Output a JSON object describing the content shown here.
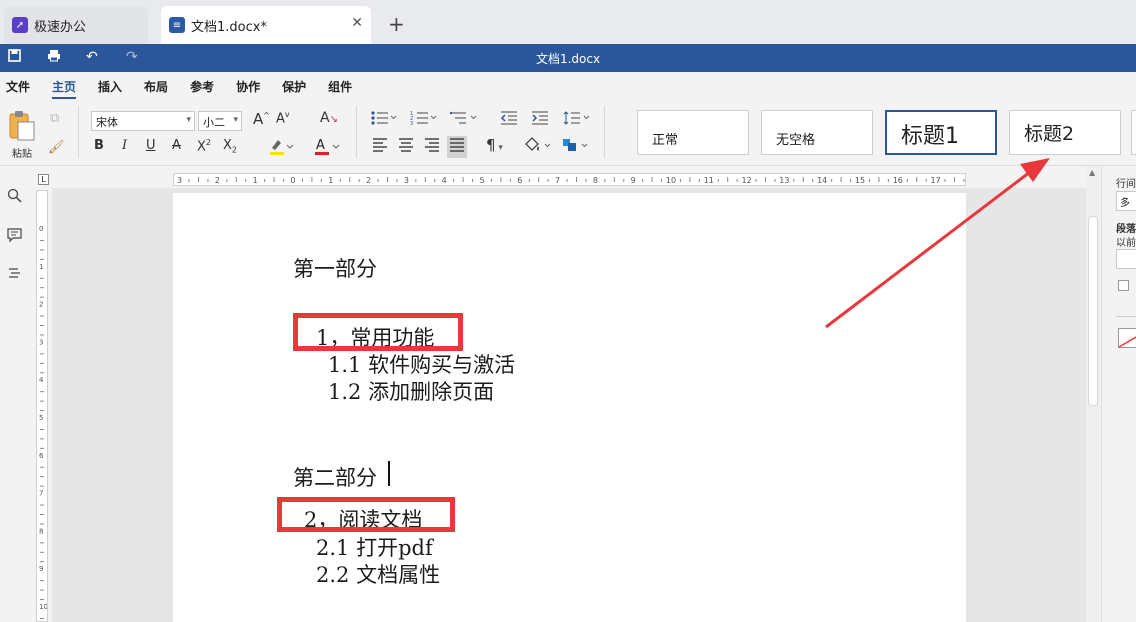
{
  "tabs": {
    "app_tab_label": "极速办公",
    "doc_tab_label": "文档1.docx*",
    "close_glyph": "✕",
    "new_tab_glyph": "+"
  },
  "titlebar": {
    "title": "文档1.docx"
  },
  "menu": [
    "文件",
    "主页",
    "插入",
    "布局",
    "参考",
    "协作",
    "保护",
    "组件"
  ],
  "menu_active": "主页",
  "ribbon": {
    "paste_label": "粘贴",
    "font_name": "宋体",
    "font_size": "小二",
    "styles": [
      "正常",
      "无空格",
      "标题1",
      "标题2"
    ]
  },
  "right_panel": {
    "line_spacing_label": "行间",
    "line_spacing_value": "多",
    "paragraph_label": "段落",
    "before_label": "以前"
  },
  "document": {
    "lines": [
      "第一部分",
      "1，常用功能",
      "1.1 软件购买与激活",
      "1.2 添加删除页面",
      "第二部分",
      "2，阅读文档",
      "2.1 打开pdf",
      "2.2 文档属性"
    ]
  },
  "annotation": {
    "highlight_color": "#e8383c",
    "arrow_color": "#e8383c"
  },
  "theme": {
    "accent": "#2b579a"
  }
}
